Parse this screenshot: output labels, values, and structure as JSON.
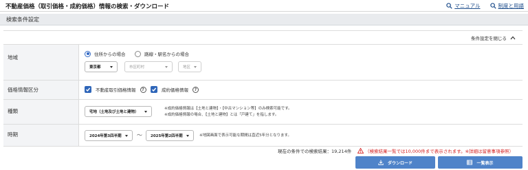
{
  "header": {
    "title": "不動産価格（取引価格・成約価格）情報の検索・ダウンロード",
    "links": [
      {
        "label": "マニュアル",
        "icon": "search-icon"
      },
      {
        "label": "制度と用語",
        "icon": "search-icon"
      }
    ]
  },
  "section": {
    "title": "検索条件設定"
  },
  "toggle": {
    "label": "条件設定を閉じる",
    "icon": "chevron-up-icon"
  },
  "area": {
    "label": "地域",
    "radio_address": "住所からの場合",
    "radio_line": "路線・駅名からの場合",
    "selected": "address",
    "prefecture": "東京都",
    "city_placeholder": "市区町村",
    "district_placeholder": "地区"
  },
  "price_type": {
    "label": "価格情報区分",
    "option_transaction": "不動産取引価格情報",
    "option_contract": "成約価格情報",
    "transaction_checked": true,
    "contract_checked": true
  },
  "kind": {
    "label": "種類",
    "selected": "宅地（土地及び土地と建物）",
    "note_1": "※成約価格情報は【土地と建物】・【中古マンション等】のみ検索可能です。",
    "note_2": "※成約価格情報の場合、【土地と建物】とは「戸建て」を指します。"
  },
  "period": {
    "label": "時期",
    "from": "2024年第3四半期",
    "separator": "〜",
    "to": "2025年第2四半期",
    "note": "※地図画面で表示可能な期間は直近5年分となります。"
  },
  "result": {
    "count_text": "現在の条件での検索結果：19,214件",
    "warning_text": "（検索結果一覧では10,000件まで表示されます。※詳細は留意事項参照）"
  },
  "buttons": {
    "download": "ダウンロード",
    "list": "一覧表示"
  },
  "colors": {
    "accent": "#4f83c9",
    "checkbox": "#2f66b9",
    "warning": "#d42020",
    "label_bg": "#f3f4f6",
    "section_bg": "#e9ebee"
  }
}
